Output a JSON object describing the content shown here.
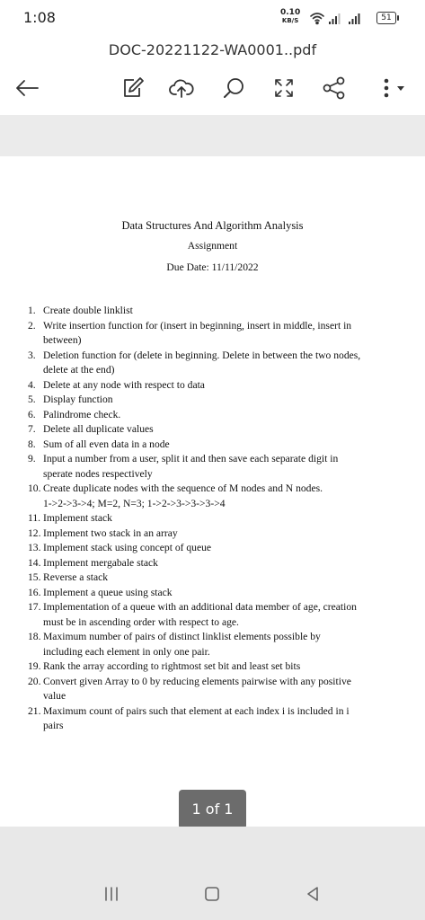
{
  "status_bar": {
    "time": "1:08",
    "net_speed": "0.10",
    "net_unit": "KB/S",
    "battery": "51"
  },
  "document": {
    "file_name": "DOC-20221122-WA0001..pdf"
  },
  "toolbar": {
    "icons": [
      "back-arrow-icon",
      "edit-icon",
      "cloud-upload-icon",
      "search-icon",
      "fullscreen-icon",
      "share-icon",
      "more-icon"
    ]
  },
  "page": {
    "title": "Data Structures And Algorithm Analysis",
    "subtitle": "Assignment",
    "due_date": "Due Date: 11/11/2022",
    "items": [
      {
        "num": "1.",
        "lines": [
          "Create double linklist"
        ]
      },
      {
        "num": "2.",
        "lines": [
          "Write insertion function for (insert in beginning, insert in middle, insert in",
          "between)"
        ]
      },
      {
        "num": "3.",
        "lines": [
          "Deletion function for (delete in beginning. Delete in between the two nodes,",
          "delete at the end)"
        ]
      },
      {
        "num": "4.",
        "lines": [
          "Delete at any node with respect to data"
        ]
      },
      {
        "num": "5.",
        "lines": [
          "Display function"
        ]
      },
      {
        "num": "6.",
        "lines": [
          "Palindrome check."
        ]
      },
      {
        "num": "7.",
        "lines": [
          "Delete all duplicate values"
        ]
      },
      {
        "num": "8.",
        "lines": [
          "Sum of all even data in a node"
        ]
      },
      {
        "num": "9.",
        "lines": [
          "Input a number from a user, split it and then save each separate digit in",
          "sperate nodes respectively"
        ]
      },
      {
        "num": "10.",
        "lines": [
          "Create duplicate nodes with the sequence of M nodes and N nodes.",
          "1->2->3->4; M=2, N=3; 1->2->3->3->3->4"
        ]
      },
      {
        "num": "11.",
        "lines": [
          "Implement stack"
        ]
      },
      {
        "num": "12.",
        "lines": [
          "Implement two stack in an array"
        ]
      },
      {
        "num": "13.",
        "lines": [
          "Implement stack using concept of queue"
        ]
      },
      {
        "num": "14.",
        "lines": [
          "Implement mergabale stack"
        ]
      },
      {
        "num": "15.",
        "lines": [
          "Reverse a stack"
        ]
      },
      {
        "num": "16.",
        "lines": [
          "Implement a queue using stack"
        ]
      },
      {
        "num": "17.",
        "lines": [
          "Implementation of a queue with an additional data member of age, creation",
          "must be in ascending order with respect to age."
        ]
      },
      {
        "num": "18.",
        "lines": [
          "Maximum number of pairs of distinct linklist elements possible by",
          "including each element in only one pair."
        ]
      },
      {
        "num": "19.",
        "lines": [
          "Rank the array according to rightmost set bit and least set bits"
        ]
      },
      {
        "num": "20.",
        "lines": [
          "Convert given Array to 0 by reducing elements pairwise with any positive",
          "value"
        ]
      },
      {
        "num": "21.",
        "lines": [
          "Maximum count of pairs such that element at each index i is included in i",
          "pairs"
        ]
      }
    ]
  },
  "page_indicator": "1 of 1",
  "nav_bar": {
    "icons": [
      "recent-apps-icon",
      "home-icon",
      "back-icon"
    ]
  }
}
